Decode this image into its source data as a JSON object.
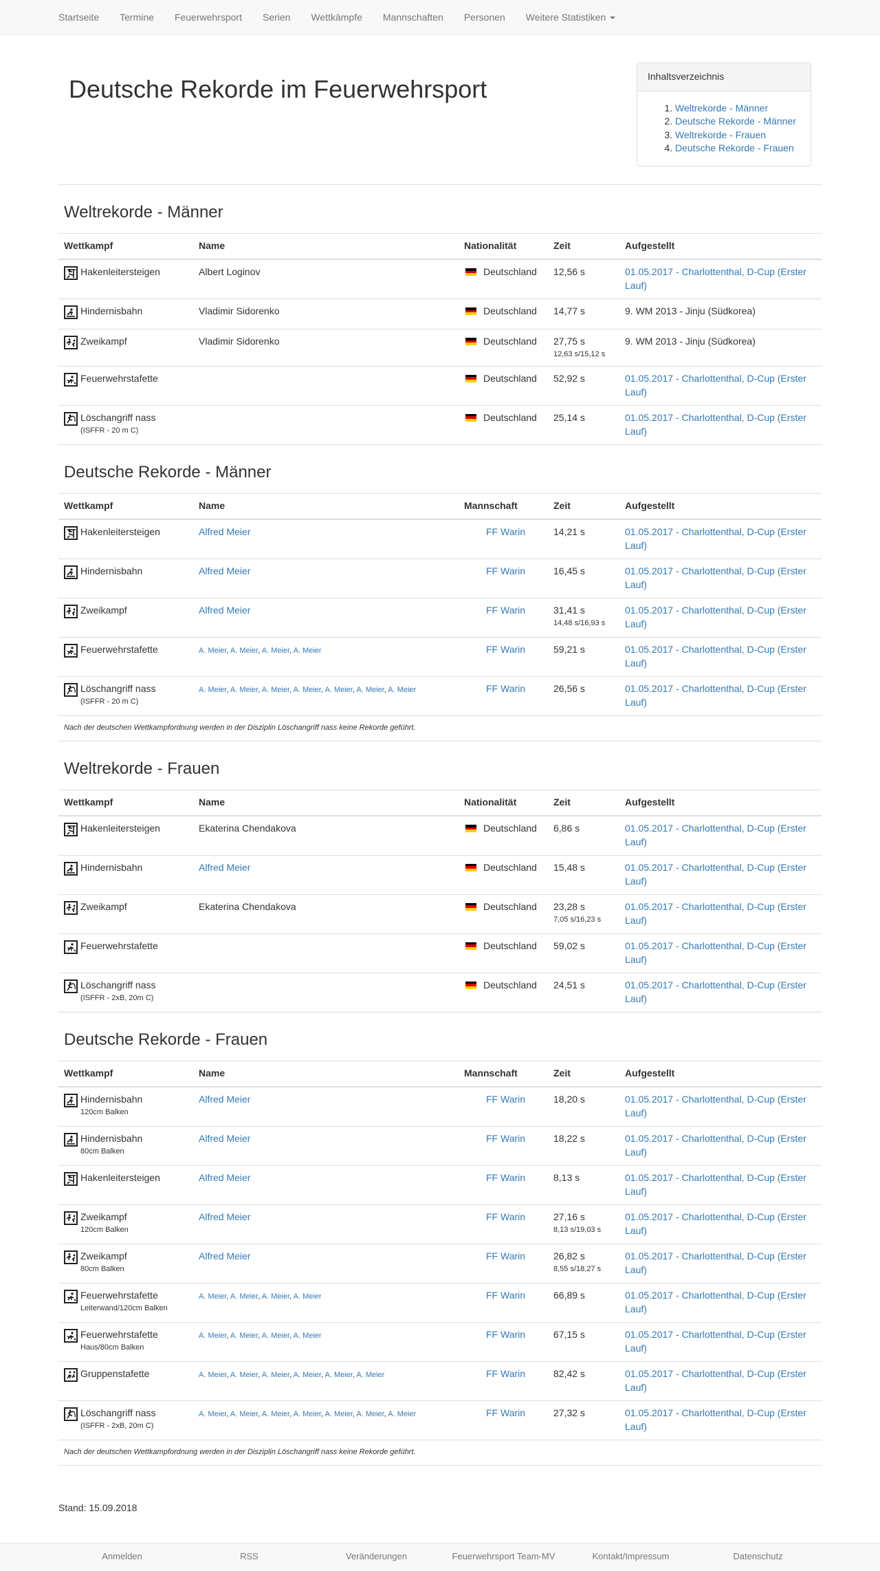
{
  "nav": {
    "items": [
      "Startseite",
      "Termine",
      "Feuerwehrsport",
      "Serien",
      "Wettkämpfe",
      "Mannschaften",
      "Personen"
    ],
    "more_label": "Weitere Statistiken"
  },
  "page": {
    "title": "Deutsche Rekorde im Feuerwehrsport"
  },
  "toc": {
    "title": "Inhaltsverzeichnis",
    "items": [
      "Weltrekorde - Männer",
      "Deutsche Rekorde - Männer",
      "Weltrekorde - Frauen",
      "Deutsche Rekorde - Frauen"
    ]
  },
  "colors": {
    "link": "#337ab7",
    "flag": [
      "#000000",
      "#dd0000",
      "#ffce00"
    ]
  },
  "sections": [
    {
      "title": "Weltrekorde - Männer",
      "headers": [
        "Wettkampf",
        "Name",
        "Nationalität",
        "Zeit",
        "Aufgestellt"
      ],
      "rows": [
        {
          "icon": "hakenleitersteigen-icon",
          "discipline": "Hakenleitersteigen",
          "sub": "",
          "name": "Albert Loginov",
          "name_link": false,
          "names_small": [],
          "team": "Deutschland",
          "flag": true,
          "time": "12,56 s",
          "time_sub": "",
          "event": "01.05.2017 - Charlottenthal, D-Cup (Erster Lauf)",
          "event_link": true
        },
        {
          "icon": "hindernisbahn-icon",
          "discipline": "Hindernisbahn",
          "sub": "",
          "name": "Vladimir Sidorenko",
          "name_link": false,
          "names_small": [],
          "team": "Deutschland",
          "flag": true,
          "time": "14,77 s",
          "time_sub": "",
          "event": "9. WM 2013 - Jinju (Südkorea)",
          "event_link": false
        },
        {
          "icon": "zweikampf-icon",
          "discipline": "Zweikampf",
          "sub": "",
          "name": "Vladimir Sidorenko",
          "name_link": false,
          "names_small": [],
          "team": "Deutschland",
          "flag": true,
          "time": "27,75 s",
          "time_sub": "12,63 s/15,12 s",
          "event": "9. WM 2013 - Jinju (Südkorea)",
          "event_link": false
        },
        {
          "icon": "feuerwehrstafette-icon",
          "discipline": "Feuerwehrstafette",
          "sub": "",
          "name": "",
          "name_link": false,
          "names_small": [],
          "team": "Deutschland",
          "flag": true,
          "time": "52,92 s",
          "time_sub": "",
          "event": "01.05.2017 - Charlottenthal, D-Cup (Erster Lauf)",
          "event_link": true
        },
        {
          "icon": "loeschangriff-icon",
          "discipline": "Löschangriff nass",
          "sub": "(ISFFR - 20 m C)",
          "name": "",
          "name_link": false,
          "names_small": [],
          "team": "Deutschland",
          "flag": true,
          "time": "25,14 s",
          "time_sub": "",
          "event": "01.05.2017 - Charlottenthal, D-Cup (Erster Lauf)",
          "event_link": true
        }
      ],
      "note": ""
    },
    {
      "title": "Deutsche Rekorde - Männer",
      "headers": [
        "Wettkampf",
        "Name",
        "Mannschaft",
        "Zeit",
        "Aufgestellt"
      ],
      "rows": [
        {
          "icon": "hakenleitersteigen-icon",
          "discipline": "Hakenleitersteigen",
          "sub": "",
          "name": "Alfred Meier",
          "name_link": true,
          "names_small": [],
          "team": "FF Warin",
          "flag": false,
          "time": "14,21 s",
          "time_sub": "",
          "event": "01.05.2017 - Charlottenthal, D-Cup (Erster Lauf)",
          "event_link": true
        },
        {
          "icon": "hindernisbahn-icon",
          "discipline": "Hindernisbahn",
          "sub": "",
          "name": "Alfred Meier",
          "name_link": true,
          "names_small": [],
          "team": "FF Warin",
          "flag": false,
          "time": "16,45 s",
          "time_sub": "",
          "event": "01.05.2017 - Charlottenthal, D-Cup (Erster Lauf)",
          "event_link": true
        },
        {
          "icon": "zweikampf-icon",
          "discipline": "Zweikampf",
          "sub": "",
          "name": "Alfred Meier",
          "name_link": true,
          "names_small": [],
          "team": "FF Warin",
          "flag": false,
          "time": "31,41 s",
          "time_sub": "14,48 s/16,93 s",
          "event": "01.05.2017 - Charlottenthal, D-Cup (Erster Lauf)",
          "event_link": true
        },
        {
          "icon": "feuerwehrstafette-icon",
          "discipline": "Feuerwehrstafette",
          "sub": "",
          "name": "",
          "name_link": false,
          "names_small": [
            "A. Meier",
            "A. Meier",
            "A. Meier",
            "A. Meier"
          ],
          "team": "FF Warin",
          "flag": false,
          "time": "59,21 s",
          "time_sub": "",
          "event": "01.05.2017 - Charlottenthal, D-Cup (Erster Lauf)",
          "event_link": true
        },
        {
          "icon": "loeschangriff-icon",
          "discipline": "Löschangriff nass",
          "sub": "(ISFFR - 20 m C)",
          "name": "",
          "name_link": false,
          "names_small": [
            "A. Meier",
            "A. Meier",
            "A. Meier",
            "A. Meier",
            "A. Meier",
            "A. Meier",
            "A. Meier"
          ],
          "team": "FF Warin",
          "flag": false,
          "time": "26,56 s",
          "time_sub": "",
          "event": "01.05.2017 - Charlottenthal, D-Cup (Erster Lauf)",
          "event_link": true
        }
      ],
      "note": "Nach der deutschen Wettkampfordnung werden in der Disziplin Löschangriff nass keine Rekorde geführt."
    },
    {
      "title": "Weltrekorde - Frauen",
      "headers": [
        "Wettkampf",
        "Name",
        "Nationalität",
        "Zeit",
        "Aufgestellt"
      ],
      "rows": [
        {
          "icon": "hakenleitersteigen-icon",
          "discipline": "Hakenleitersteigen",
          "sub": "",
          "name": "Ekaterina Chendakova",
          "name_link": false,
          "names_small": [],
          "team": "Deutschland",
          "flag": true,
          "time": "6,86 s",
          "time_sub": "",
          "event": "01.05.2017 - Charlottenthal, D-Cup (Erster Lauf)",
          "event_link": true
        },
        {
          "icon": "hindernisbahn-icon",
          "discipline": "Hindernisbahn",
          "sub": "",
          "name": "Alfred Meier",
          "name_link": true,
          "names_small": [],
          "team": "Deutschland",
          "flag": true,
          "time": "15,48 s",
          "time_sub": "",
          "event": "01.05.2017 - Charlottenthal, D-Cup (Erster Lauf)",
          "event_link": true
        },
        {
          "icon": "zweikampf-icon",
          "discipline": "Zweikampf",
          "sub": "",
          "name": "Ekaterina Chendakova",
          "name_link": false,
          "names_small": [],
          "team": "Deutschland",
          "flag": true,
          "time": "23,28 s",
          "time_sub": "7,05 s/16,23 s",
          "event": "01.05.2017 - Charlottenthal, D-Cup (Erster Lauf)",
          "event_link": true
        },
        {
          "icon": "feuerwehrstafette-icon",
          "discipline": "Feuerwehrstafette",
          "sub": "",
          "name": "",
          "name_link": false,
          "names_small": [],
          "team": "Deutschland",
          "flag": true,
          "time": "59,02 s",
          "time_sub": "",
          "event": "01.05.2017 - Charlottenthal, D-Cup (Erster Lauf)",
          "event_link": true
        },
        {
          "icon": "loeschangriff-icon",
          "discipline": "Löschangriff nass",
          "sub": "(ISFFR - 2xB, 20m C)",
          "name": "",
          "name_link": false,
          "names_small": [],
          "team": "Deutschland",
          "flag": true,
          "time": "24,51 s",
          "time_sub": "",
          "event": "01.05.2017 - Charlottenthal, D-Cup (Erster Lauf)",
          "event_link": true
        }
      ],
      "note": ""
    },
    {
      "title": "Deutsche Rekorde - Frauen",
      "headers": [
        "Wettkampf",
        "Name",
        "Mannschaft",
        "Zeit",
        "Aufgestellt"
      ],
      "rows": [
        {
          "icon": "hindernisbahn-icon",
          "discipline": "Hindernisbahn",
          "sub": "120cm Balken",
          "name": "Alfred Meier",
          "name_link": true,
          "names_small": [],
          "team": "FF Warin",
          "flag": false,
          "time": "18,20 s",
          "time_sub": "",
          "event": "01.05.2017 - Charlottenthal, D-Cup (Erster Lauf)",
          "event_link": true
        },
        {
          "icon": "hindernisbahn-icon",
          "discipline": "Hindernisbahn",
          "sub": "80cm Balken",
          "name": "Alfred Meier",
          "name_link": true,
          "names_small": [],
          "team": "FF Warin",
          "flag": false,
          "time": "18,22 s",
          "time_sub": "",
          "event": "01.05.2017 - Charlottenthal, D-Cup (Erster Lauf)",
          "event_link": true
        },
        {
          "icon": "hakenleitersteigen-icon",
          "discipline": "Hakenleitersteigen",
          "sub": "",
          "name": "Alfred Meier",
          "name_link": true,
          "names_small": [],
          "team": "FF Warin",
          "flag": false,
          "time": "8,13 s",
          "time_sub": "",
          "event": "01.05.2017 - Charlottenthal, D-Cup (Erster Lauf)",
          "event_link": true
        },
        {
          "icon": "zweikampf-icon",
          "discipline": "Zweikampf",
          "sub": "120cm Balken",
          "name": "Alfred Meier",
          "name_link": true,
          "names_small": [],
          "team": "FF Warin",
          "flag": false,
          "time": "27,16 s",
          "time_sub": "8,13 s/19,03 s",
          "event": "01.05.2017 - Charlottenthal, D-Cup (Erster Lauf)",
          "event_link": true
        },
        {
          "icon": "zweikampf-icon",
          "discipline": "Zweikampf",
          "sub": "80cm Balken",
          "name": "Alfred Meier",
          "name_link": true,
          "names_small": [],
          "team": "FF Warin",
          "flag": false,
          "time": "26,82 s",
          "time_sub": "8,55 s/18,27 s",
          "event": "01.05.2017 - Charlottenthal, D-Cup (Erster Lauf)",
          "event_link": true
        },
        {
          "icon": "feuerwehrstafette-icon",
          "discipline": "Feuerwehrstafette",
          "sub": "Leiterwand/120cm Balken",
          "name": "",
          "name_link": false,
          "names_small": [
            "A. Meier",
            "A. Meier",
            "A. Meier",
            "A. Meier"
          ],
          "team": "FF Warin",
          "flag": false,
          "time": "66,89 s",
          "time_sub": "",
          "event": "01.05.2017 - Charlottenthal, D-Cup (Erster Lauf)",
          "event_link": true
        },
        {
          "icon": "feuerwehrstafette-icon",
          "discipline": "Feuerwehrstafette",
          "sub": "Haus/80cm Balken",
          "name": "",
          "name_link": false,
          "names_small": [
            "A. Meier",
            "A. Meier",
            "A. Meier",
            "A. Meier"
          ],
          "team": "FF Warin",
          "flag": false,
          "time": "67,15 s",
          "time_sub": "",
          "event": "01.05.2017 - Charlottenthal, D-Cup (Erster Lauf)",
          "event_link": true
        },
        {
          "icon": "gruppenstafette-icon",
          "discipline": "Gruppenstafette",
          "sub": "",
          "name": "",
          "name_link": false,
          "names_small": [
            "A. Meier",
            "A. Meier",
            "A. Meier",
            "A. Meier",
            "A. Meier",
            "A. Meier"
          ],
          "team": "FF Warin",
          "flag": false,
          "time": "82,42 s",
          "time_sub": "",
          "event": "01.05.2017 - Charlottenthal, D-Cup (Erster Lauf)",
          "event_link": true
        },
        {
          "icon": "loeschangriff-icon",
          "discipline": "Löschangriff nass",
          "sub": "(ISFFR - 2xB, 20m C)",
          "name": "",
          "name_link": false,
          "names_small": [
            "A. Meier",
            "A. Meier",
            "A. Meier",
            "A. Meier",
            "A. Meier",
            "A. Meier",
            "A. Meier"
          ],
          "team": "FF Warin",
          "flag": false,
          "time": "27,32 s",
          "time_sub": "",
          "event": "01.05.2017 - Charlottenthal, D-Cup (Erster Lauf)",
          "event_link": true
        }
      ],
      "note": "Nach der deutschen Wettkampfordnung werden in der Disziplin Löschangriff nass keine Rekorde geführt."
    }
  ],
  "stand": "Stand: 15.09.2018",
  "footer": {
    "items": [
      "Anmelden",
      "RSS",
      "Veränderungen",
      "Feuerwehrsport Team-MV",
      "Kontakt/Impressum",
      "Datenschutz"
    ]
  }
}
